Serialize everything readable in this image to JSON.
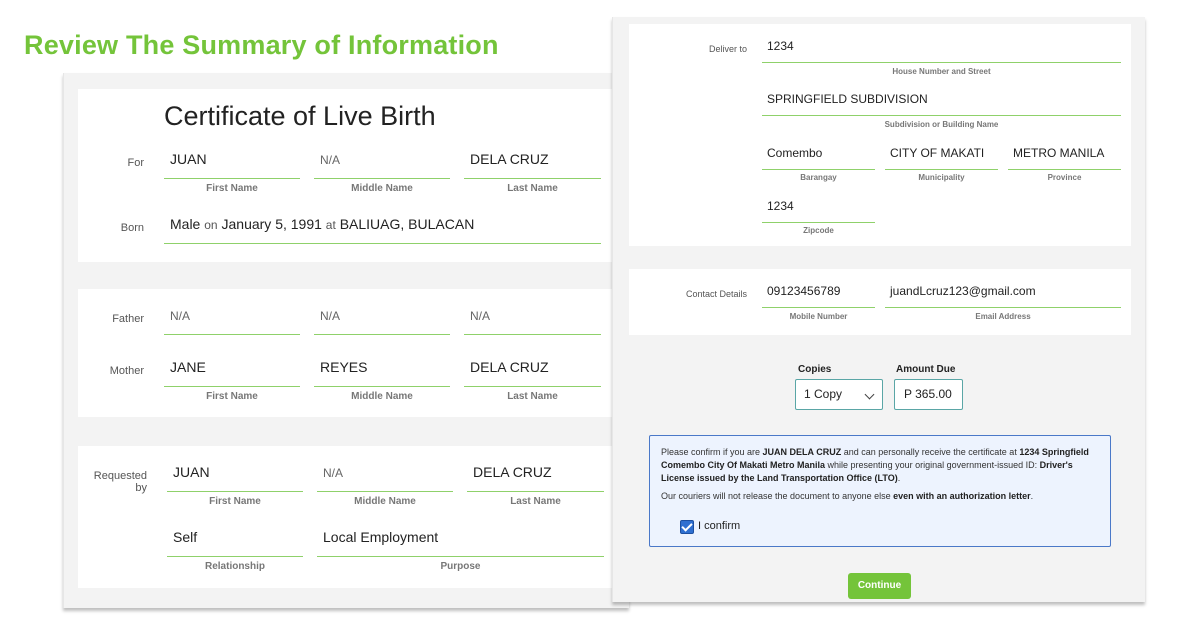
{
  "page": {
    "title": "Review The Summary of Information",
    "accent_color": "#74c43a"
  },
  "birth": {
    "title": "Certificate of Live Birth",
    "for_label": "For",
    "first_name": "JUAN",
    "middle_name": "N/A",
    "last_name": "DELA CRUZ",
    "first_name_caption": "First Name",
    "middle_name_caption": "Middle Name",
    "last_name_caption": "Last Name",
    "born_label": "Born",
    "sex": "Male",
    "on_word": "on",
    "birth_date": "January 5, 1991",
    "at_word": "at",
    "birth_place": "BALIUAG, BULACAN"
  },
  "parents": {
    "father_label": "Father",
    "father": {
      "first": "N/A",
      "middle": "N/A",
      "last": "N/A"
    },
    "mother_label": "Mother",
    "mother": {
      "first": "JANE",
      "middle": "REYES",
      "last": "DELA CRUZ"
    },
    "first_caption": "First Name",
    "middle_caption": "Middle Name",
    "last_caption": "Last Name"
  },
  "requester": {
    "label": "Requested by",
    "first": "JUAN",
    "middle": "N/A",
    "last": "DELA CRUZ",
    "first_caption": "First Name",
    "middle_caption": "Middle Name",
    "last_caption": "Last Name",
    "relationship": "Self",
    "relationship_caption": "Relationship",
    "purpose": "Local Employment",
    "purpose_caption": "Purpose"
  },
  "delivery": {
    "label": "Deliver to",
    "house_number": "1234",
    "house_caption": "House Number and Street",
    "subdivision": "SPRINGFIELD SUBDIVISION",
    "subdivision_caption": "Subdivision or Building Name",
    "barangay": "Comembo",
    "barangay_caption": "Barangay",
    "municipality": "CITY OF MAKATI",
    "municipality_caption": "Municipality",
    "province": "METRO MANILA",
    "province_caption": "Province",
    "zipcode": "1234",
    "zipcode_caption": "Zipcode"
  },
  "contact": {
    "label": "Contact Details",
    "mobile": "09123456789",
    "mobile_caption": "Mobile Number",
    "email": "juandLcruz123@gmail.com",
    "email_caption": "Email Address"
  },
  "order": {
    "copies_label": "Copies",
    "copies_value": "1 Copy",
    "amount_label": "Amount Due",
    "amount_value": "P 365.00"
  },
  "confirm": {
    "t1": "Please confirm if you are ",
    "b1": "JUAN DELA CRUZ",
    "t2": " and can personally receive the certificate at ",
    "b2": "1234 Springfield Comembo City Of Makati Metro Manila",
    "t3": " while presenting your original government-issued ID: ",
    "b3": "Driver's License issued by the Land Transportation Office (LTO)",
    "t4": ".",
    "t5": "Our couriers will not release the document to anyone else ",
    "b4": "even with an authorization letter",
    "t6": ".",
    "checkbox_label": "I confirm",
    "checked": true,
    "checkbox_color": "#2f6fd0"
  },
  "actions": {
    "continue_label": "Continue"
  }
}
